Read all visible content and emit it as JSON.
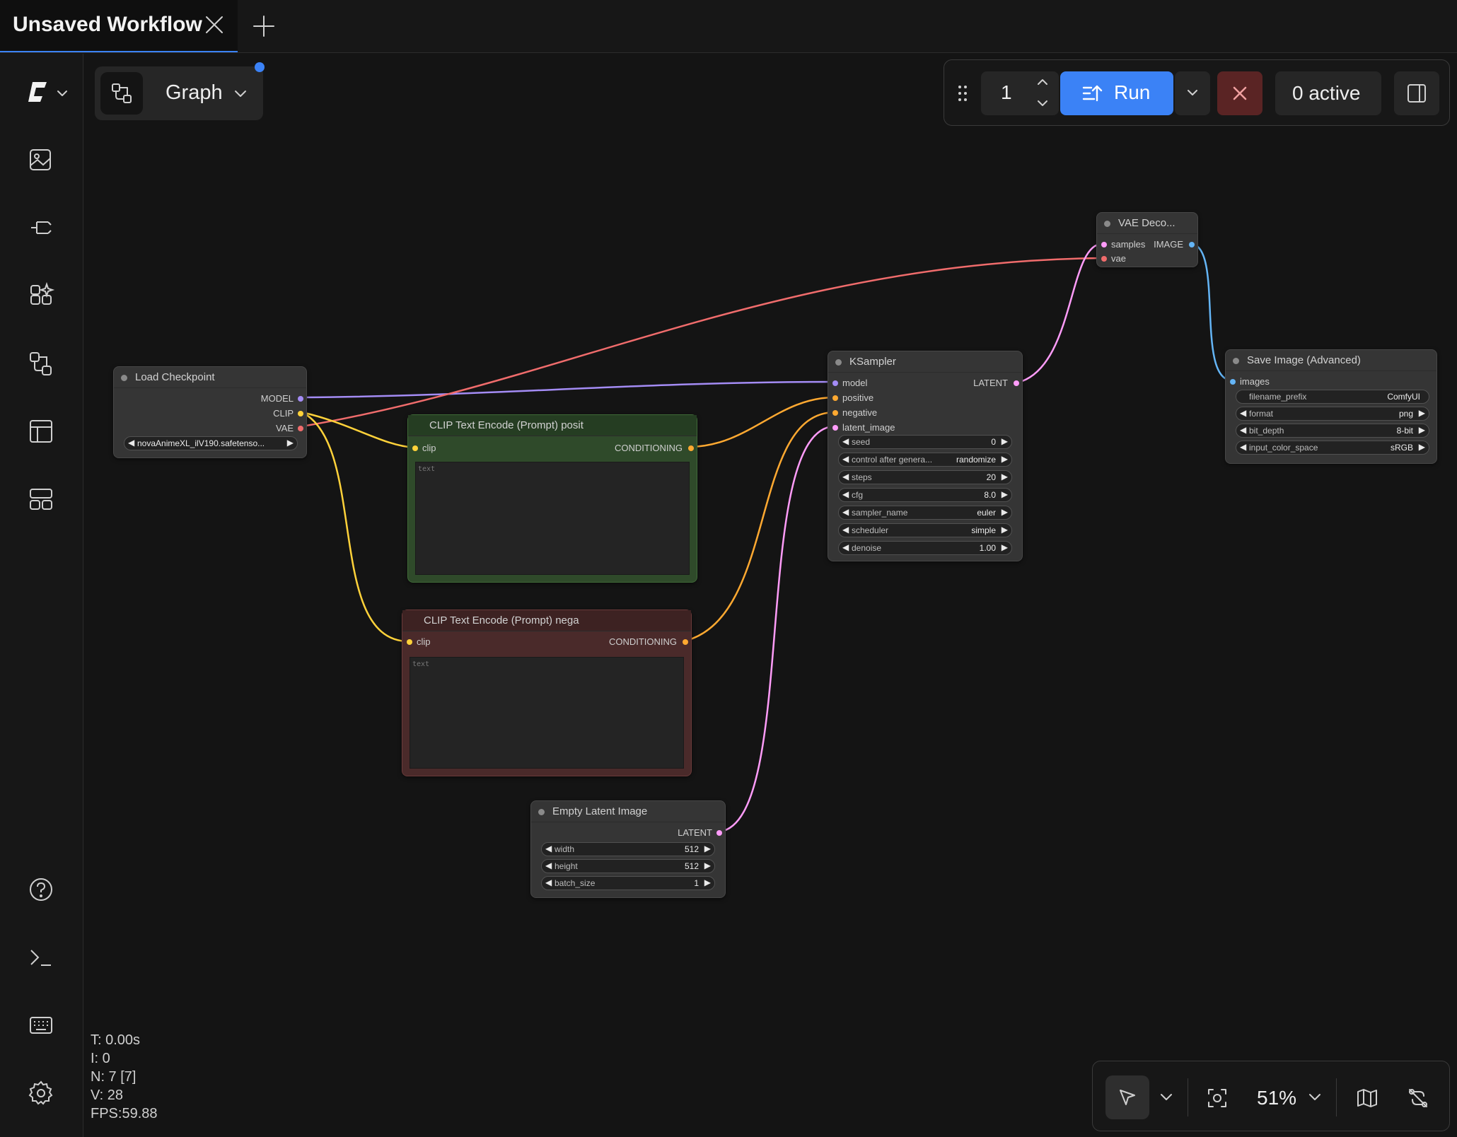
{
  "tabs": {
    "active_title": "Unsaved Workflow"
  },
  "graph_selector": {
    "label": "Graph"
  },
  "run_bar": {
    "queue_count": "1",
    "run_label": "Run",
    "active_label": "0 active"
  },
  "canvas_controls": {
    "zoom": "51%"
  },
  "stats": {
    "t": "T: 0.00s",
    "i": "I: 0",
    "n": "N: 7 [7]",
    "v": "V: 28",
    "fps": "FPS:59.88"
  },
  "nodes": {
    "load_checkpoint": {
      "title": "Load Checkpoint",
      "out_model": "MODEL",
      "out_clip": "CLIP",
      "out_vae": "VAE",
      "ckpt_value": "novaAnimeXL_ilV190.safetenso..."
    },
    "clip_pos": {
      "title": "CLIP Text Encode (Prompt) posit",
      "in_clip": "clip",
      "out": "CONDITIONING",
      "placeholder": "text"
    },
    "clip_neg": {
      "title": "CLIP Text Encode (Prompt) nega",
      "in_clip": "clip",
      "out": "CONDITIONING",
      "placeholder": "text"
    },
    "empty_latent": {
      "title": "Empty Latent Image",
      "out": "LATENT",
      "widgets": [
        {
          "label": "width",
          "value": "512"
        },
        {
          "label": "height",
          "value": "512"
        },
        {
          "label": "batch_size",
          "value": "1"
        }
      ]
    },
    "ksampler": {
      "title": "KSampler",
      "in_model": "model",
      "in_positive": "positive",
      "in_negative": "negative",
      "in_latent": "latent_image",
      "out": "LATENT",
      "widgets": [
        {
          "label": "seed",
          "value": "0"
        },
        {
          "label": "control after genera...",
          "value": "randomize"
        },
        {
          "label": "steps",
          "value": "20"
        },
        {
          "label": "cfg",
          "value": "8.0"
        },
        {
          "label": "sampler_name",
          "value": "euler"
        },
        {
          "label": "scheduler",
          "value": "simple"
        },
        {
          "label": "denoise",
          "value": "1.00"
        }
      ]
    },
    "vae_decode": {
      "title": "VAE Deco...",
      "in_samples": "samples",
      "in_vae": "vae",
      "out": "IMAGE"
    },
    "save_image": {
      "title": "Save Image (Advanced)",
      "in_images": "images",
      "widgets": [
        {
          "label": "filename_prefix",
          "value": "ComfyUI"
        },
        {
          "label": "format",
          "value": "png"
        },
        {
          "label": "bit_depth",
          "value": "8-bit"
        },
        {
          "label": "input_color_space",
          "value": "sRGB"
        }
      ]
    }
  },
  "colors": {
    "model": "#a48cf5",
    "clip": "#ffd23a",
    "vae": "#f06c6c",
    "conditioning": "#ffa931",
    "latent": "#ff9cf9",
    "image": "#64b5f6",
    "accent": "#3b82f6"
  }
}
